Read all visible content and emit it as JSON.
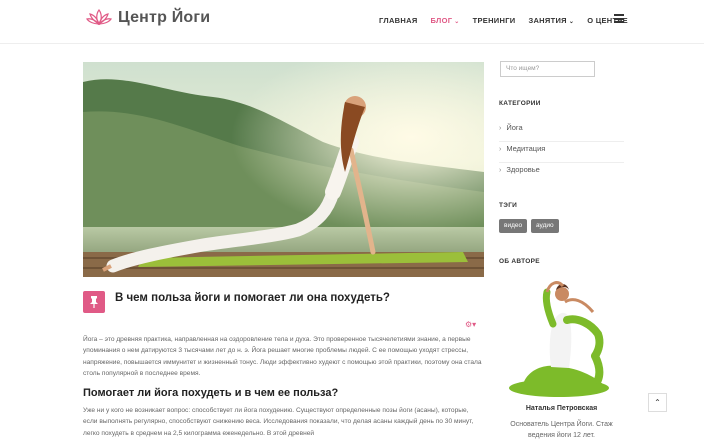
{
  "header": {
    "logo_text": "Центр Йоги",
    "nav": [
      {
        "label": "ГЛАВНАЯ",
        "active": false,
        "dropdown": false
      },
      {
        "label": "БЛОГ",
        "active": true,
        "dropdown": true
      },
      {
        "label": "ТРЕНИНГИ",
        "active": false,
        "dropdown": false
      },
      {
        "label": "ЗАНЯТИЯ",
        "active": false,
        "dropdown": true
      },
      {
        "label": "О ЦЕНТРЕ",
        "active": false,
        "dropdown": false
      }
    ],
    "menu_icon": "hamburger-icon"
  },
  "post": {
    "title": "В чем польза йоги и помогает ли она похудеть?",
    "paragraph1": "Йога – это древняя практика, направленная на оздоровление тела и духа. Это проверенное тысячелетиями знание, а первые упоминания о нем датируются 3 тысячами лет до н. э. Йога решает многие проблемы людей. С ее помощью уходят стрессы, напряжение, повышается иммунитет и жизненный тонус. Люди эффективно худеют с помощью этой практики, поэтому она стала столь популярной в последнее время.",
    "subtitle": "Помогает ли йога похудеть и в чем ее польза?",
    "paragraph2": "Уже ни у кого не возникает вопрос: способствует ли йога похудению. Существуют определенные позы йоги (асаны), которые, если выполнять регулярно, способствуют снижению веса. Исследования показали, что делая асаны каждый день по 30 минут, легко похудеть в среднем на 2,5 килограмма еженедельно. В этой древней"
  },
  "sidebar": {
    "search_placeholder": "Что ищем?",
    "categories_title": "КАТЕГОРИИ",
    "categories": [
      "Йога",
      "Медитация",
      "Здоровье"
    ],
    "tags_title": "ТЭГИ",
    "tags": [
      "видео",
      "аудио"
    ],
    "author_title": "ОБ АВТОРЕ",
    "author_name": "Наталья Петровская",
    "author_desc": "Основатель Центра Йоги. Стаж ведения йоги 12 лет."
  },
  "colors": {
    "accent": "#e05a86",
    "text": "#333333",
    "tag_bg": "#777777"
  }
}
